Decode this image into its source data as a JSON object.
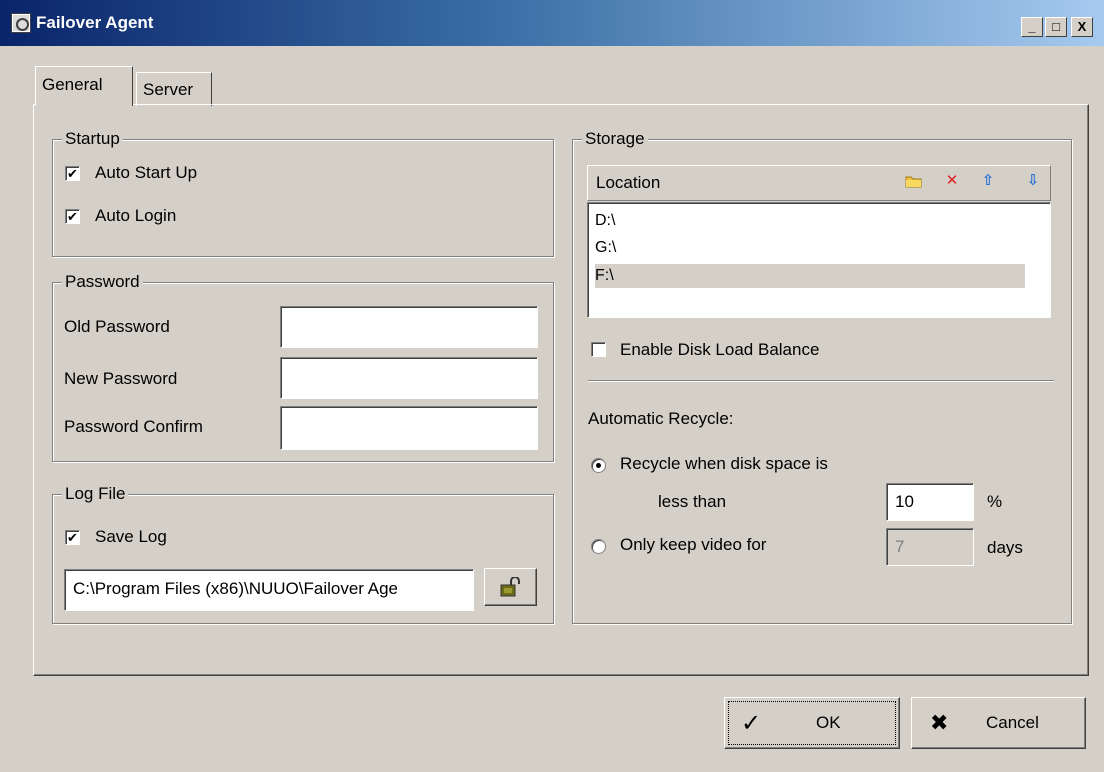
{
  "window": {
    "title": "Failover Agent",
    "minimize": "_",
    "maximize": "□",
    "close": "X"
  },
  "tabs": [
    {
      "label": "General"
    },
    {
      "label": "Server"
    }
  ],
  "startup": {
    "legend": "Startup",
    "auto_start": {
      "label": "Auto Start Up",
      "checked": true
    },
    "auto_login": {
      "label": "Auto Login",
      "checked": true
    }
  },
  "password": {
    "legend": "Password",
    "old_label": "Old Password",
    "old_value": "",
    "new_label": "New Password",
    "new_value": "",
    "confirm_label": "Password Confirm",
    "confirm_value": ""
  },
  "logfile": {
    "legend": "Log File",
    "save_log": {
      "label": "Save Log",
      "checked": true
    },
    "path": "C:\\Program Files (x86)\\NUUO\\Failover Age"
  },
  "storage": {
    "legend": "Storage",
    "location_header": "Location",
    "locations": [
      "D:\\",
      "G:\\",
      "F:\\"
    ],
    "selected_index": 2,
    "load_balance": {
      "label": "Enable Disk Load Balance",
      "checked": false
    },
    "recycle_heading": "Automatic Recycle:",
    "recycle_disk": {
      "label": "Recycle when disk space is",
      "label2": "less than",
      "value": "10",
      "unit": "%",
      "selected": true
    },
    "recycle_days": {
      "label": "Only keep video for",
      "value": "7",
      "unit": "days",
      "selected": false
    }
  },
  "buttons": {
    "ok": "OK",
    "cancel": "Cancel"
  },
  "glyphs": {
    "check": "✔",
    "x_mark": "✖",
    "tick": "✓",
    "delete": "✕",
    "up": "⇧",
    "down": "⇩"
  },
  "colors": {
    "titlebar_start": "#0a246a",
    "titlebar_end": "#a6caf0",
    "face": "#d4d0c8",
    "delete_red": "#e02020",
    "arrow_blue": "#2b6fd6",
    "folder_yellow": "#f0c040"
  }
}
